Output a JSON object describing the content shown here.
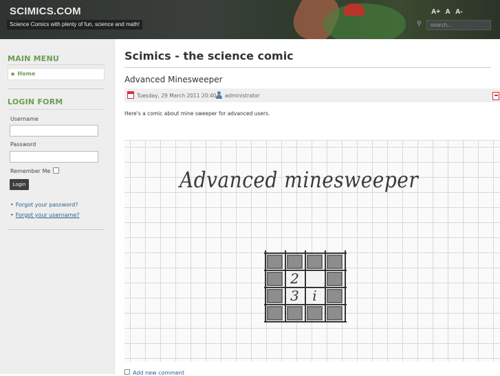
{
  "header": {
    "site_title": "SCIMICS.COM",
    "tagline": "Science Comics with plenty of fun, science and math!",
    "font_size_controls": [
      "A+",
      "A",
      "A-"
    ],
    "search_placeholder": "search..."
  },
  "sidebar": {
    "main_menu_title": "MAIN MENU",
    "menu_items": [
      {
        "label": "Home"
      }
    ],
    "login_title": "LOGIN FORM",
    "username_label": "Username",
    "password_label": "Password",
    "remember_label": "Remember Me",
    "login_button": "Login",
    "links": [
      {
        "label": "Forgot your password?"
      },
      {
        "label": "Forgot your username?"
      }
    ]
  },
  "main": {
    "page_title": "Scimics - the science comic",
    "article_title": "Advanced Minesweeper",
    "date": "Tuesday, 29 March 2011 20:40",
    "author": "administrator",
    "intro": "Here's a comic about mine sweeper for advanced users.",
    "comic": {
      "heading": "Advanced minesweeper",
      "numbers": [
        "2",
        "3",
        "i"
      ]
    },
    "add_comment": "Add new comment"
  },
  "colors": {
    "accent_green": "#6a9d50",
    "link_blue": "#2a5f8f",
    "header_dark": "#2f3431"
  }
}
